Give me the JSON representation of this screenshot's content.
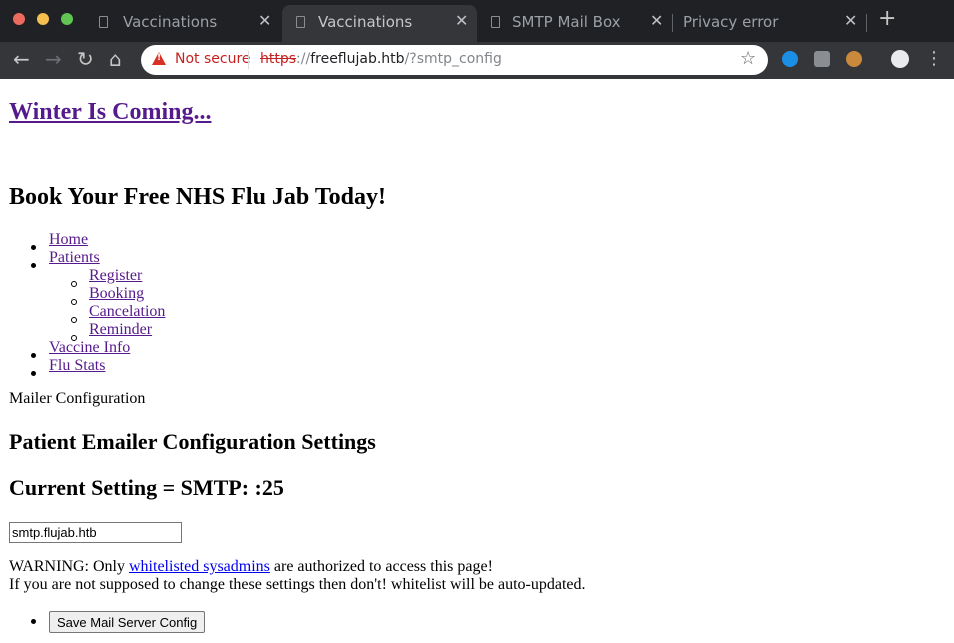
{
  "browser": {
    "tabs": [
      {
        "title": "Vaccinations",
        "active": false
      },
      {
        "title": "Vaccinations",
        "active": true
      },
      {
        "title": "SMTP Mail Box",
        "active": false
      },
      {
        "title": "Privacy error",
        "active": false
      }
    ],
    "tab_close_glyph": "✕",
    "new_tab_glyph": "+",
    "security_label": "Not secure",
    "url": {
      "scheme": "https",
      "separator": "://",
      "host": "freeflujab.htb",
      "path": "/?smtp_config"
    },
    "icons": [
      "back-arrow-icon",
      "forward-arrow-icon",
      "reload-icon",
      "home-icon",
      "warning-icon",
      "star-icon",
      "extension-icons",
      "profile-avatar",
      "kebab-menu-icon"
    ],
    "colors": {
      "tabbar_bg": "#202124",
      "toolbar_bg": "#35363a",
      "warning_red": "#d93025"
    }
  },
  "page": {
    "site_title": "Winter Is Coming...",
    "hero_heading": "Book Your Free NHS Flu Jab Today!",
    "nav": {
      "home": "Home",
      "patients": "Patients",
      "patients_sub": [
        "Register",
        "Booking",
        "Cancelation",
        "Reminder"
      ],
      "vaccine_info": "Vaccine Info",
      "flu_stats": "Flu Stats"
    },
    "mailer_label": "Mailer Configuration",
    "config_heading": "Patient Emailer Configuration Settings",
    "current_setting": "Current Setting = SMTP: :25",
    "smtp_input_value": "smtp.flujab.htb",
    "warning_prefix": "WARNING: Only ",
    "warning_link": "whitelisted sysadmins",
    "warning_suffix": " are authorized to access this page!",
    "advice": "If you are not supposed to change these settings then don't! whitelist will be auto-updated.",
    "save_button": "Save Mail Server Config"
  }
}
